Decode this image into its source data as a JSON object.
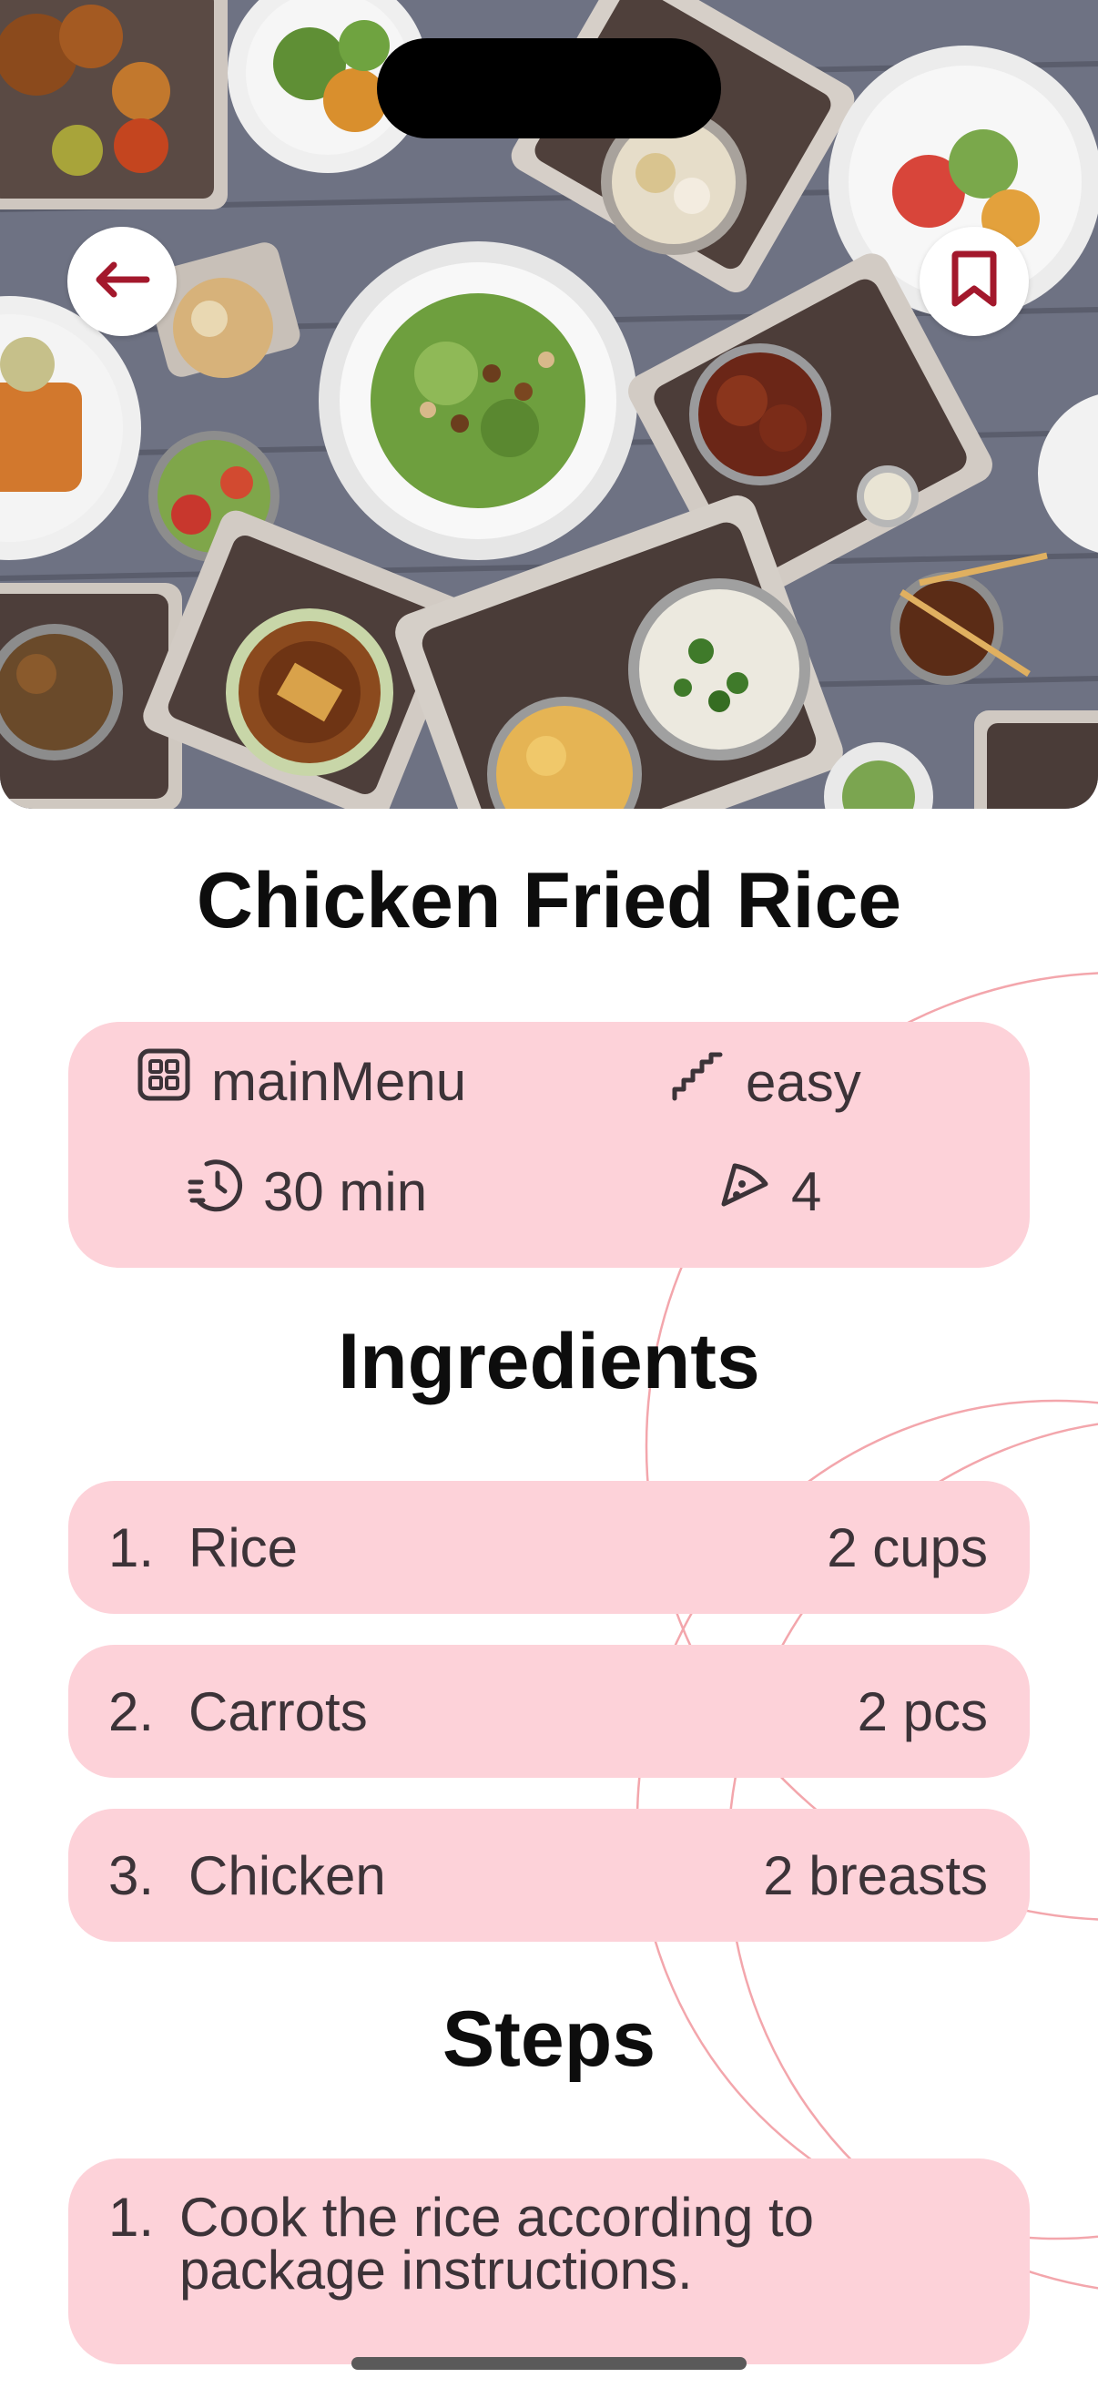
{
  "recipe": {
    "title": "Chicken Fried Rice",
    "category": "mainMenu",
    "difficulty": "easy",
    "time": "30 min",
    "servings": "4"
  },
  "sections": {
    "ingredients_title": "Ingredients",
    "steps_title": "Steps"
  },
  "ingredients": [
    {
      "num": "1.",
      "name": "Rice",
      "qty": "2 cups"
    },
    {
      "num": "2.",
      "name": "Carrots",
      "qty": "2 pcs"
    },
    {
      "num": "3.",
      "name": "Chicken",
      "qty": "2 breasts"
    }
  ],
  "steps": [
    {
      "num": "1.",
      "text": "Cook the rice according to package instructions."
    }
  ],
  "icons": {
    "back": "arrow-left-icon",
    "bookmark": "bookmark-icon",
    "category": "grid-icon",
    "difficulty": "stairs-icon",
    "time": "clock-icon",
    "servings": "pizza-slice-icon"
  },
  "colors": {
    "accent": "#a3182c",
    "card_bg": "#fdd2d9",
    "text": "#3c3338",
    "deco_line": "#f3a6ac"
  }
}
